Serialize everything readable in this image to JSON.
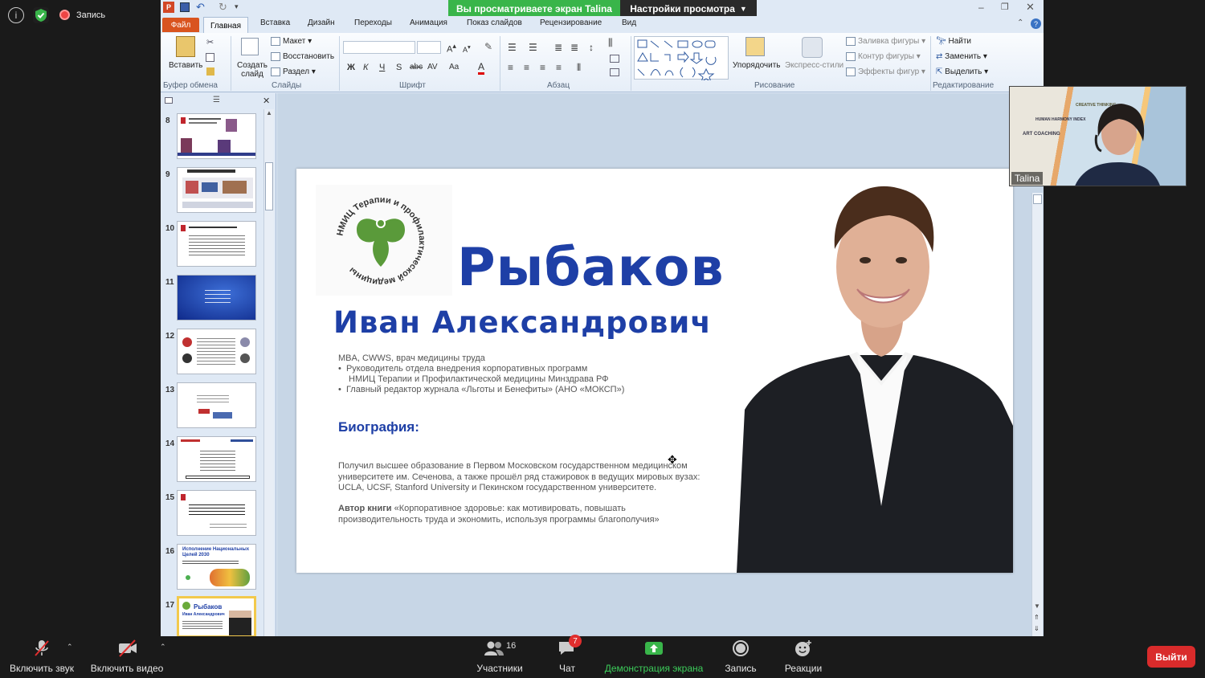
{
  "zoom_top": {
    "record_label": "Запись"
  },
  "share": {
    "viewing_label": "Вы просматриваете экран Talina",
    "view_settings_label": "Настройки просмотра"
  },
  "ppt": {
    "tabs": [
      "Главная",
      "Вставка",
      "Дизайн",
      "Переходы",
      "Анимация",
      "Показ слайдов",
      "Рецензирование",
      "Вид"
    ],
    "file_tab": "Файл",
    "ribbon": {
      "paste": "Вставить",
      "clipboard_group": "Буфер обмена",
      "new_slide": "Создать слайд",
      "layout": "Макет",
      "reset": "Восстановить",
      "section": "Раздел",
      "slides_group": "Слайды",
      "font_group": "Шрифт",
      "paragraph_group": "Абзац",
      "arrange": "Упорядочить",
      "quick_styles": "Экспресс-стили",
      "shape_fill": "Заливка фигуры",
      "shape_outline": "Контур фигуры",
      "shape_effects": "Эффекты фигур",
      "drawing_group": "Рисование",
      "find": "Найти",
      "replace": "Заменить",
      "select": "Выделить",
      "editing_group": "Редактирование",
      "font_buttons": [
        "Ж",
        "К",
        "Ч",
        "S",
        "abc",
        "AV",
        "Aa",
        "A"
      ]
    },
    "slide_numbers": [
      "8",
      "9",
      "10",
      "11",
      "12",
      "13",
      "14",
      "15",
      "16",
      "17"
    ],
    "thumb16_text": "Исполнение Национальных Целей 2030",
    "thumb17_title": "Рыбаков",
    "thumb17_sub": "Иван Александрович"
  },
  "slide": {
    "logo_text": "НМИЦ Терапии и профилактической медицины",
    "surname": "Рыбаков",
    "name": "Иван Александрович",
    "line1": "MBA, CWWS, врач медицины труда",
    "bullet1a": "Руководитель отдела внедрения корпоративных программ",
    "bullet1b": "НМИЦ Терапии  и Профилактической  медицины Минздрава РФ",
    "bullet2": "Главный редактор журнала «Льготы и Бенефиты»  (АНО «МОКСП»)",
    "bio_title": "Биография:",
    "bio_p1": "Получил высшее образование  в Первом  Московском государственном медицинском университете им. Сеченова, а также прошёл ряд стажировок в ведущих мировых вузах: UCLA, UCSF, Stanford  University и Пекинском государственном университете.",
    "bio_p2_bold": "Автор книги",
    "bio_p2_rest": " «Корпоративное  здоровье: как мотивировать,  повышать производительность труда и экономить, используя программы благополучия»",
    "title_color": "#1e3fa6"
  },
  "video": {
    "participant_name": "Talina",
    "bg_text1": "HUMAN HARMONY INDEX",
    "bg_text2": "ART COACHING",
    "bg_text3": "CREATIVE THINKING"
  },
  "zoom_bottom": {
    "unmute": "Включить звук",
    "start_video": "Включить видео",
    "participants": "Участники",
    "participants_count": "16",
    "chat": "Чат",
    "chat_badge": "7",
    "share_screen": "Демонстрация экрана",
    "record": "Запись",
    "reactions": "Реакции",
    "leave": "Выйти"
  }
}
